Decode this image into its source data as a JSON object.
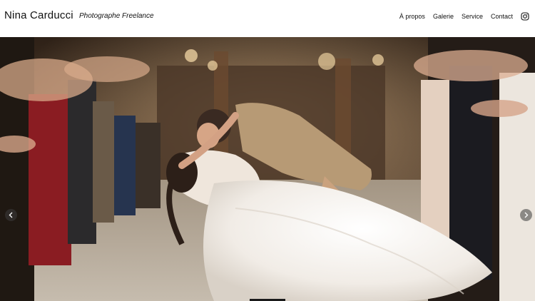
{
  "header": {
    "brand_name": "Nina Carducci",
    "tagline": "Photographe Freelance"
  },
  "nav": {
    "items": [
      {
        "label": "À propos"
      },
      {
        "label": "Galerie"
      },
      {
        "label": "Service"
      },
      {
        "label": "Contact"
      }
    ],
    "social_icon": "instagram-icon"
  },
  "carousel": {
    "prev_icon": "chevron-left-icon",
    "next_icon": "chevron-right-icon"
  }
}
